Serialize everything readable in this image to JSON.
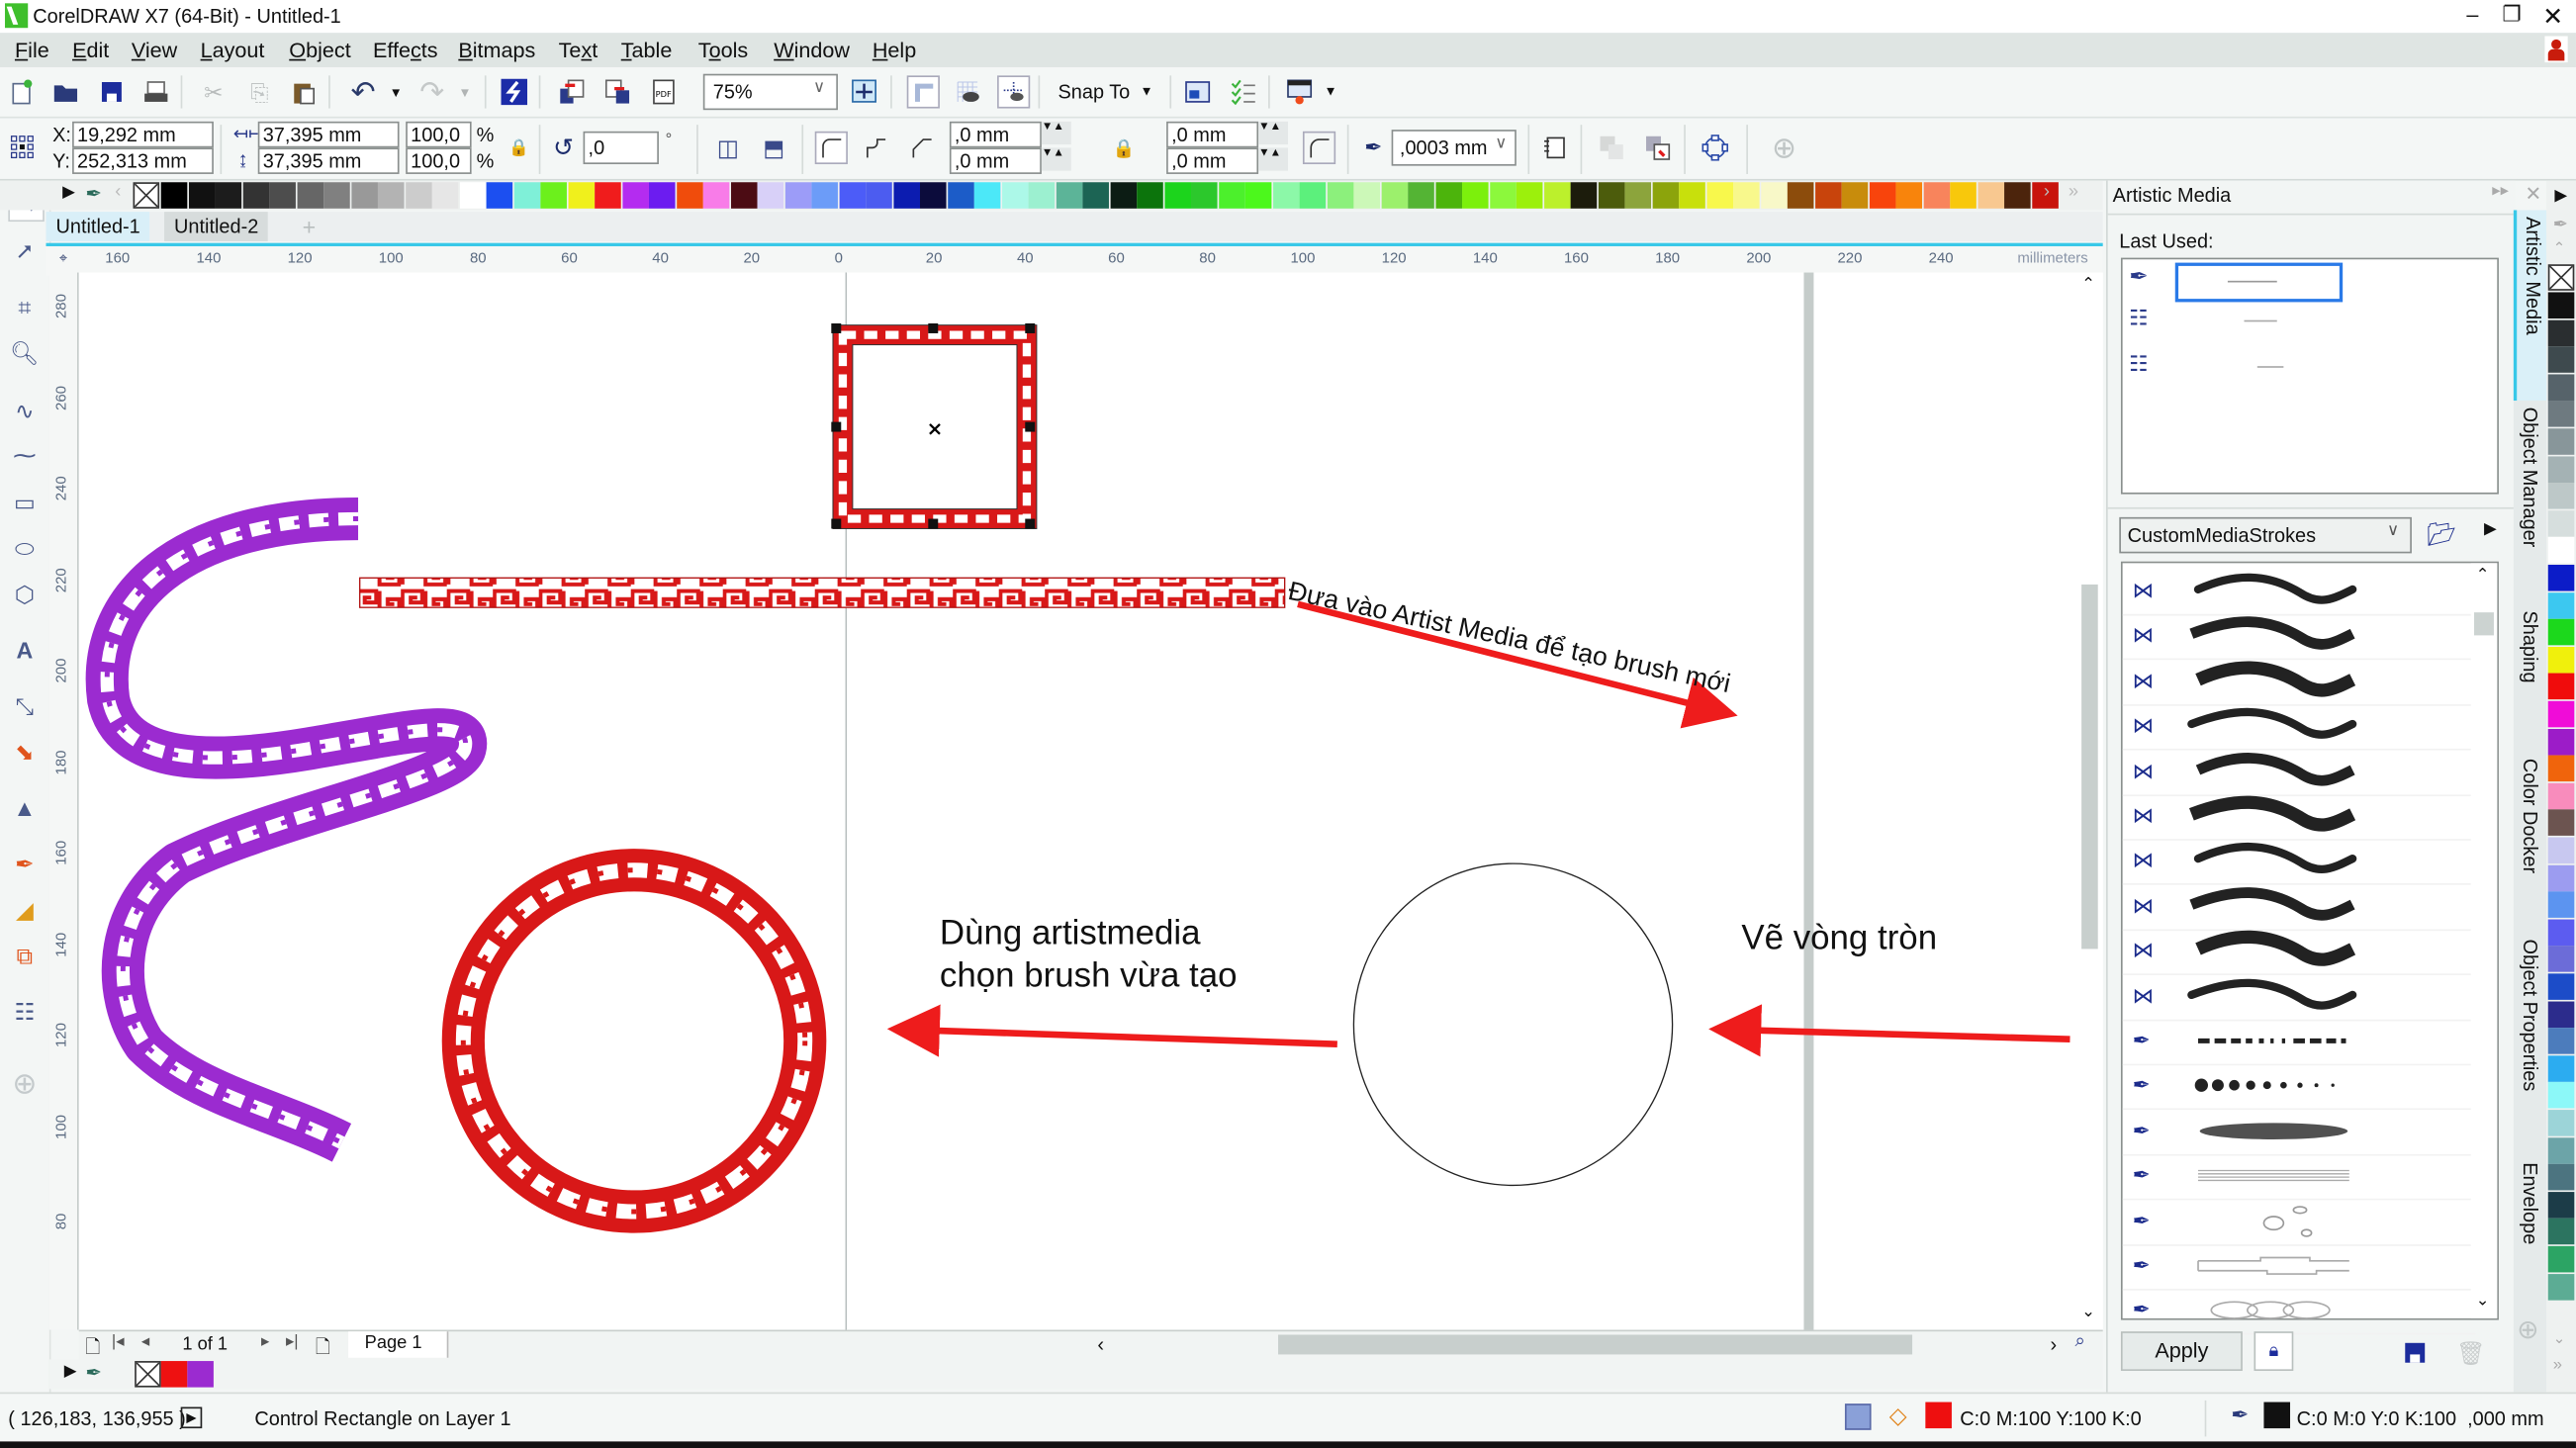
{
  "window": {
    "title": "CorelDRAW X7 (64-Bit) - Untitled-1",
    "controls": [
      "minimize-icon",
      "restore-icon",
      "close-icon"
    ]
  },
  "menu": [
    "File",
    "Edit",
    "View",
    "Layout",
    "Object",
    "Effects",
    "Bitmaps",
    "Text",
    "Table",
    "Tools",
    "Window",
    "Help"
  ],
  "standard_toolbar": {
    "zoom_level": "75%",
    "snap_to": "Snap To"
  },
  "property_bar": {
    "x": "19,292 mm",
    "y": "252,313 mm",
    "x_label": "X:",
    "y_label": "Y:",
    "width": "37,395 mm",
    "height": "37,395 mm",
    "scale_w": "100,0",
    "scale_h": "100,0",
    "percent": "%",
    "rotation": ",0",
    "degree": "°",
    "corner_tl": ",0 mm",
    "corner_bl": ",0 mm",
    "corner_tr": ",0 mm",
    "corner_br": ",0 mm",
    "outline_width": ",0003 mm"
  },
  "palette_colors": [
    "#000000",
    "#111111",
    "#1c1c1c",
    "#333333",
    "#4d4d4d",
    "#666666",
    "#808080",
    "#999999",
    "#b3b3b3",
    "#cccccc",
    "#e6e6e6",
    "#ffffff",
    "#1c4ff0",
    "#7ff0d8",
    "#6cf01c",
    "#f0f01c",
    "#f01c1c",
    "#b42cf0",
    "#6c1cf0",
    "#f04c0c",
    "#f87ce8",
    "#4c0c14",
    "#d8d0f8",
    "#9c9cf8",
    "#6c9cf8",
    "#4c5cf8",
    "#4c5cf0",
    "#0c1cb0",
    "#0c0c3c",
    "#1c5cc8",
    "#4ce8f8",
    "#acf8e8",
    "#9cf0d0",
    "#5cb498",
    "#1c6454",
    "#0c1c14",
    "#0c740c",
    "#1cd41c",
    "#2cc82c",
    "#4cf02c",
    "#4cf81c",
    "#8cf8a8",
    "#5cf07c",
    "#8cf07c",
    "#ccf8b8",
    "#9cf06c",
    "#54b434",
    "#4cb40c",
    "#7cf00c",
    "#8cf83c",
    "#9cf00c",
    "#bcf02c",
    "#1c1c0c",
    "#4c5c0c",
    "#8ca43c",
    "#8ca40c",
    "#c8e00c",
    "#f8f84c",
    "#f8f88c",
    "#f8f8c8",
    "#8c4c0c",
    "#c8440c",
    "#c88c0c",
    "#f8440c",
    "#f8840c",
    "#f8845c",
    "#f8c80c",
    "#f8c890",
    "#4c240c",
    "#c8140c"
  ],
  "doc_tabs": [
    "Untitled-1",
    "Untitled-2"
  ],
  "ruler": {
    "top_ticks": [
      "160",
      "140",
      "120",
      "100",
      "80",
      "60",
      "40",
      "20",
      "0",
      "20",
      "40",
      "60",
      "80",
      "100",
      "120",
      "140",
      "160",
      "180",
      "200",
      "220",
      "240"
    ],
    "units": "millimeters",
    "left_ticks": [
      "280",
      "260",
      "240",
      "220",
      "200",
      "180",
      "160",
      "140",
      "120",
      "100",
      "80"
    ]
  },
  "canvas": {
    "annotation_1": "Đưa vào Artist Media để tạo brush mới",
    "annotation_2_line1": "Dùng artistmedia",
    "annotation_2_line2": "chọn brush vừa tạo",
    "annotation_3": "Vẽ vòng tròn",
    "colors": {
      "red": "#e01818",
      "purple": "#9b2bd0",
      "arrow": "#ee1c1c"
    }
  },
  "page_nav": {
    "page_count": "1 of 1",
    "page_tab": "Page 1"
  },
  "doc_palette": [
    "#ee1111",
    "#9b2bd0"
  ],
  "status": {
    "cursor": "( 126,183, 136,955 )",
    "object_info": "Control Rectangle on Layer 1",
    "fill": "C:0 M:100 Y:100 K:0",
    "fill_color": "#ee0f0f",
    "outline": "C:0 M:0 Y:0 K:100  ,000 mm",
    "outline_color": "#111111"
  },
  "docker": {
    "title": "Artistic Media",
    "last_used_label": "Last Used:",
    "library": "CustomMediaStrokes",
    "apply": "Apply",
    "tabs": [
      "Artistic Media",
      "Object Manager",
      "Shaping",
      "Color Docker",
      "Object Properties",
      "Envelope"
    ]
  },
  "right_palette": [
    "#111111",
    "#2a2e30",
    "#3e4a4e",
    "#56636a",
    "#6e7a80",
    "#88969a",
    "#a4b2b4",
    "#bdc8c8",
    "#d6dedd",
    "#ffffff",
    "#0c1cc8",
    "#3cc8f0",
    "#1cd81c",
    "#f0f00c",
    "#f00c0c",
    "#f00cd8",
    "#9c1cc8",
    "#f0640c",
    "#f88cbc",
    "#6c5450",
    "#c8c8f0",
    "#9c9cf0",
    "#5c94f0",
    "#5c5cf0",
    "#6c6cd8",
    "#1c4cc8",
    "#2c2c8c",
    "#4c7cbc",
    "#2cacf0",
    "#8cf8f8",
    "#9cd4d8",
    "#6ca4a8",
    "#4c7480",
    "#1c3c48",
    "#2c7460",
    "#2ca464",
    "#5cac94"
  ]
}
